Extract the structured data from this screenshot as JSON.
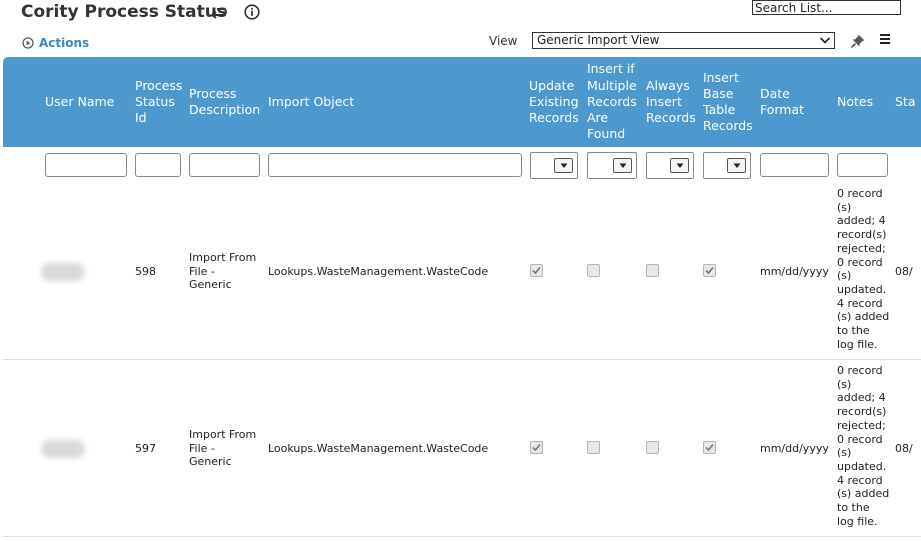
{
  "app": {
    "title": "Cority Process Status"
  },
  "toolbar": {
    "search_value": "Search List...",
    "actions_label": "Actions",
    "view_label": "View",
    "view_selected": "Generic Import View"
  },
  "colors": {
    "header_bg": "#4d98cd",
    "accent": "#3a87c2"
  },
  "icons": [
    "undo-icon",
    "info-icon",
    "play-circle-icon",
    "pin-icon",
    "menu-icon",
    "chevron-down-icon",
    "checkmark-icon"
  ],
  "columns": [
    "User Name",
    "Process\nStatus\nId",
    "Process\nDescription",
    "Import Object",
    "Update\nExisting\nRecords",
    "Insert if\nMultiple\nRecords\nAre\nFound",
    "Always\nInsert\nRecords",
    "Insert\nBase\nTable\nRecords",
    "Date\nFormat",
    "Notes",
    "Sta"
  ],
  "rows": [
    {
      "status_id": "598",
      "description": "Import From\nFile -\nGeneric",
      "import_object": "Lookups.WasteManagement.WasteCode",
      "update_existing": true,
      "insert_if_multiple": false,
      "always_insert": false,
      "insert_base_table": true,
      "date_format": "mm/dd/yyyy",
      "notes": "0 record\n(s)\nadded; 4\nrecord(s)\nrejected;\n0 record\n(s)\nupdated.\n4 record\n(s) added\nto the\nlog file.",
      "start": "08/"
    },
    {
      "status_id": "597",
      "description": "Import From\nFile -\nGeneric",
      "import_object": "Lookups.WasteManagement.WasteCode",
      "update_existing": true,
      "insert_if_multiple": false,
      "always_insert": false,
      "insert_base_table": true,
      "date_format": "mm/dd/yyyy",
      "notes": "0 record\n(s)\nadded; 4\nrecord(s)\nrejected;\n0 record\n(s)\nupdated.\n4 record\n(s) added\nto the\nlog file.",
      "start": "08/"
    }
  ]
}
